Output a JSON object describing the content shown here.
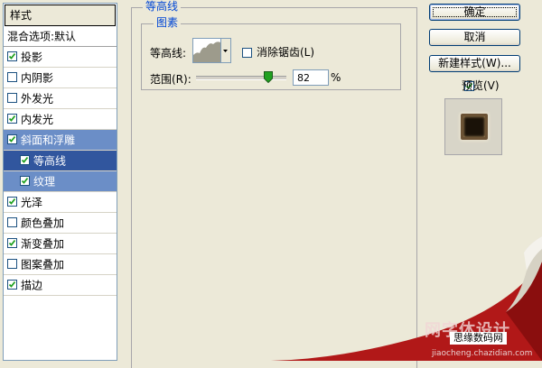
{
  "styles_panel": {
    "header": "样式",
    "items": [
      {
        "label": "混合选项:默认",
        "checkbox": false,
        "checked": false,
        "state": "normal",
        "indent": false
      },
      {
        "label": "投影",
        "checkbox": true,
        "checked": true,
        "state": "normal",
        "indent": false
      },
      {
        "label": "内阴影",
        "checkbox": true,
        "checked": false,
        "state": "normal",
        "indent": false
      },
      {
        "label": "外发光",
        "checkbox": true,
        "checked": false,
        "state": "normal",
        "indent": false
      },
      {
        "label": "内发光",
        "checkbox": true,
        "checked": true,
        "state": "normal",
        "indent": false
      },
      {
        "label": "斜面和浮雕",
        "checkbox": true,
        "checked": true,
        "state": "sel-main",
        "indent": false
      },
      {
        "label": "等高线",
        "checkbox": true,
        "checked": true,
        "state": "sel-active",
        "indent": true
      },
      {
        "label": "纹理",
        "checkbox": true,
        "checked": true,
        "state": "sel-sub",
        "indent": true
      },
      {
        "label": "光泽",
        "checkbox": true,
        "checked": true,
        "state": "normal",
        "indent": false
      },
      {
        "label": "颜色叠加",
        "checkbox": true,
        "checked": false,
        "state": "normal",
        "indent": false
      },
      {
        "label": "渐变叠加",
        "checkbox": true,
        "checked": true,
        "state": "normal",
        "indent": false
      },
      {
        "label": "图案叠加",
        "checkbox": true,
        "checked": false,
        "state": "normal",
        "indent": false
      },
      {
        "label": "描边",
        "checkbox": true,
        "checked": true,
        "state": "normal",
        "indent": false
      }
    ]
  },
  "contour_section": {
    "title": "等高线",
    "subgroup_title": "图素",
    "contour_label": "等高线:",
    "antialias_label": "消除锯齿(L)",
    "antialias_checked": false,
    "range_label": "范围(R):",
    "range_value": "82",
    "range_unit": "%",
    "range_fraction": 0.82
  },
  "buttons": {
    "ok": "确定",
    "cancel": "取消",
    "new_style": "新建样式(W)...",
    "preview_label": "预览(V)",
    "preview_checked": true
  },
  "watermarks": {
    "stamp": "思缘数码网",
    "big": "网字体设计",
    "url": "jiaocheng.chazidian.com"
  },
  "colors": {
    "selection_dark": "#31569e",
    "selection_light": "#6b8ec7",
    "group_title": "#0046d5",
    "checkmark": "#21a121",
    "curl_red": "#b11818"
  }
}
